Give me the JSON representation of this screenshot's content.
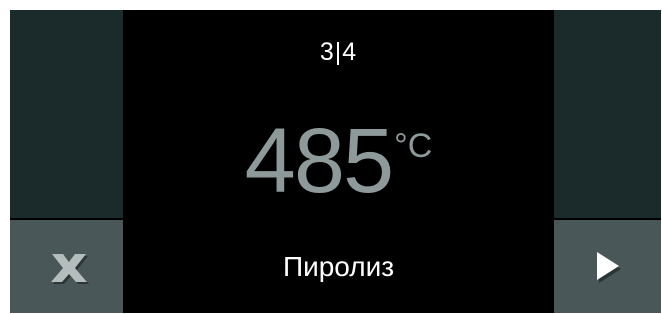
{
  "display": {
    "step": "3|4",
    "temperature": "485",
    "temperature_unit": "°C",
    "program": "Пиролиз"
  },
  "buttons": {
    "cancel_icon": "close-icon",
    "next_icon": "play-arrow-icon"
  },
  "colors": {
    "background": "#000000",
    "side_panel": "#1b2b2c",
    "button": "#4a5758",
    "temperature_text": "#8e9a9a",
    "text": "#ffffff"
  }
}
